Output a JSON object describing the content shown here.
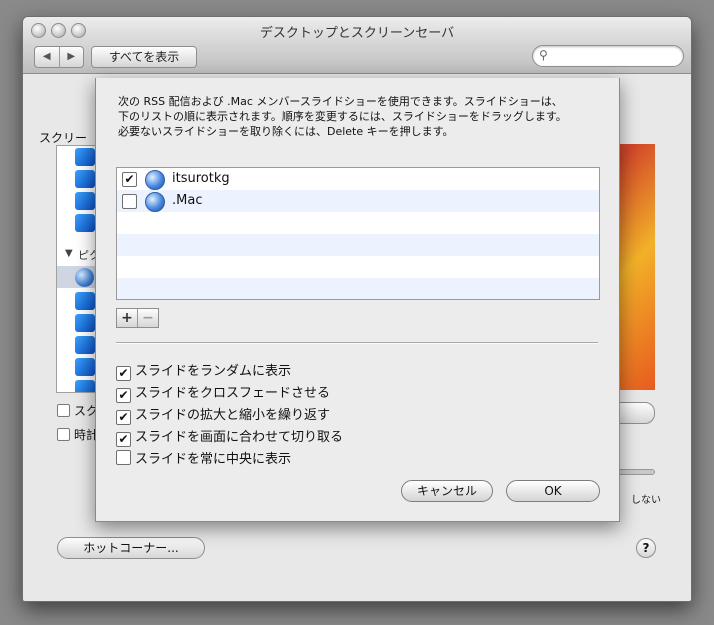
{
  "window": {
    "title": "デスクトップとスクリーンセーバ",
    "back_glyph": "◀",
    "forward_glyph": "▶",
    "show_all": "すべてを表示",
    "search_placeholder": ""
  },
  "background_panel": {
    "list_label": "スクリー",
    "group_label": "ピク",
    "checkbox_1": "スク",
    "checkbox_2": "時計",
    "never_label": "しない",
    "hot_corner_button": "ホットコーナー...",
    "help_glyph": "?"
  },
  "sheet": {
    "description": [
      "次の RSS 配信および .Mac メンバースライドショーを使用できます。スライドショーは、",
      "下のリストの順に表示されます。順序を変更するには、スライドショーをドラッグします。",
      "必要ないスライドショーを取り除くには、Delete キーを押します。"
    ],
    "feeds": [
      {
        "name": "itsurotkg",
        "checked": true
      },
      {
        "name": ".Mac",
        "checked": false
      }
    ],
    "add_glyph": "+",
    "remove_glyph": "−",
    "options": [
      {
        "label": "スライドをランダムに表示",
        "checked": true
      },
      {
        "label": "スライドをクロスフェードさせる",
        "checked": true
      },
      {
        "label": "スライドの拡大と縮小を繰り返す",
        "checked": true
      },
      {
        "label": "スライドを画面に合わせて切り取る",
        "checked": true
      },
      {
        "label": "スライドを常に中央に表示",
        "checked": false
      }
    ],
    "cancel_button": "キャンセル",
    "ok_button": "OK"
  }
}
